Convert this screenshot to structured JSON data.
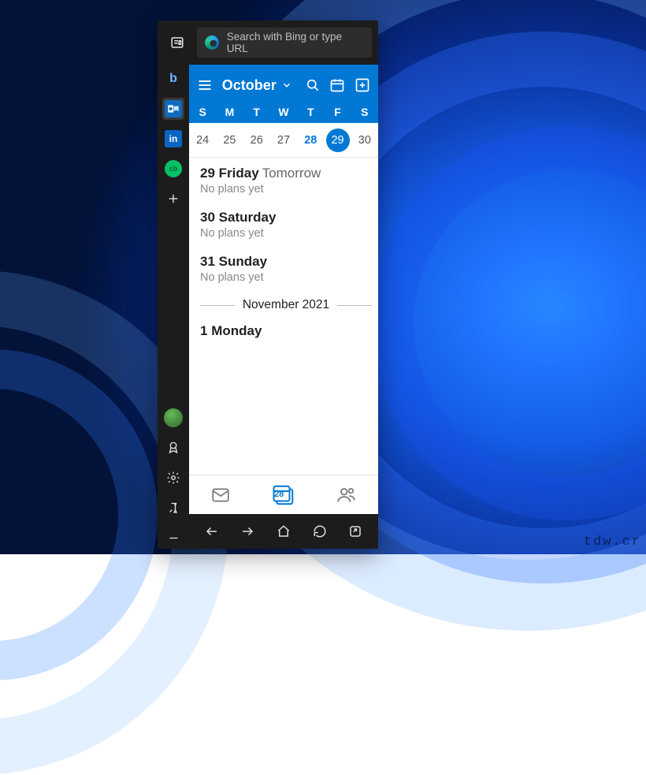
{
  "search": {
    "placeholder": "Search with Bing or type URL"
  },
  "rail": {
    "bing": "b",
    "linkedin": "in",
    "cb": "cb"
  },
  "calendar": {
    "month_label": "October",
    "dow": [
      "S",
      "M",
      "T",
      "W",
      "T",
      "F",
      "S"
    ],
    "dates": [
      "24",
      "25",
      "26",
      "27",
      "28",
      "29",
      "30"
    ],
    "today_index": 5,
    "highlight_index": 4
  },
  "agenda": {
    "days": [
      {
        "num": "29",
        "name": "Friday",
        "rel": "Tomorrow",
        "note": "No plans yet"
      },
      {
        "num": "30",
        "name": "Saturday",
        "rel": "",
        "note": "No plans yet"
      },
      {
        "num": "31",
        "name": "Sunday",
        "rel": "",
        "note": "No plans yet"
      }
    ],
    "next_month": "November 2021",
    "next_day": {
      "num": "1",
      "name": "Monday"
    }
  },
  "tabbar": {
    "calendar_badge": "28"
  },
  "watermark": "tdw.cr"
}
